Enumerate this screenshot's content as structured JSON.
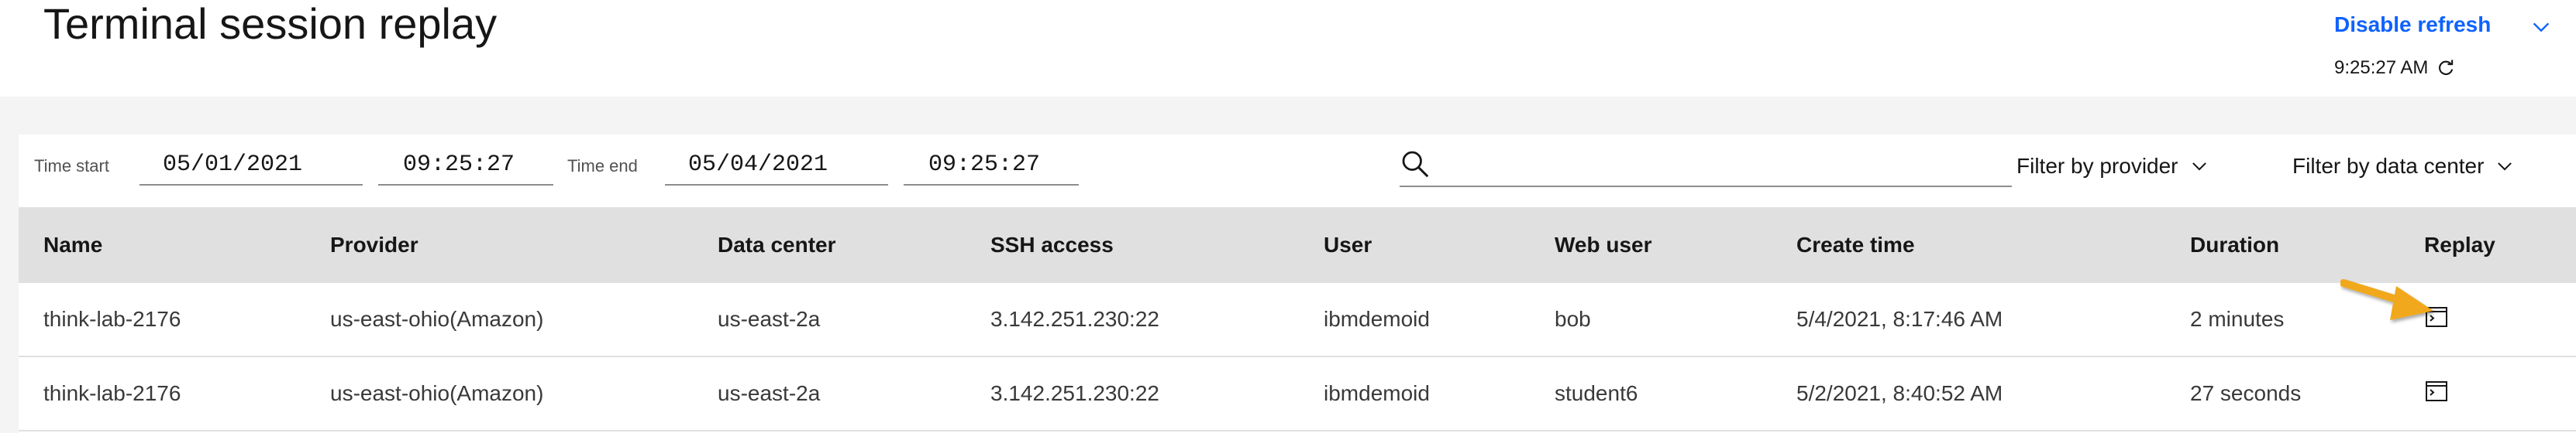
{
  "header": {
    "title": "Terminal session replay",
    "refresh_label": "Disable refresh",
    "refresh_time": "9:25:27 AM"
  },
  "filters": {
    "time_start_label": "Time start",
    "start_date": "05/01/2021",
    "start_time": "09:25:27",
    "time_end_label": "Time end",
    "end_date": "05/04/2021",
    "end_time": "09:25:27",
    "search_value": "",
    "provider_dropdown": "Filter by provider",
    "datacenter_dropdown": "Filter by data center"
  },
  "table": {
    "columns": [
      "Name",
      "Provider",
      "Data center",
      "SSH access",
      "User",
      "Web user",
      "Create time",
      "Duration",
      "Replay"
    ],
    "rows": [
      [
        "think-lab-2176",
        "us-east-ohio(Amazon)",
        "us-east-2a",
        "3.142.251.230:22",
        "ibmdemoid",
        "bob",
        "5/4/2021, 8:17:46 AM",
        "2 minutes"
      ],
      [
        "think-lab-2176",
        "us-east-ohio(Amazon)",
        "us-east-2a",
        "3.142.251.230:22",
        "ibmdemoid",
        "student6",
        "5/2/2021, 8:40:52 AM",
        "27 seconds"
      ]
    ]
  },
  "icons": {
    "refresh_chevron": "chevron-down-icon",
    "refresh": "refresh-icon",
    "search": "search-icon",
    "dropdown": "chevron-down-icon",
    "replay": "terminal-icon",
    "annotation": "arrow-icon"
  },
  "colors": {
    "link_blue": "#0f62fe",
    "header_row_bg": "#e0e0e0",
    "page_bg": "#f4f4f4",
    "annotation_arrow": "#f1a81b"
  }
}
